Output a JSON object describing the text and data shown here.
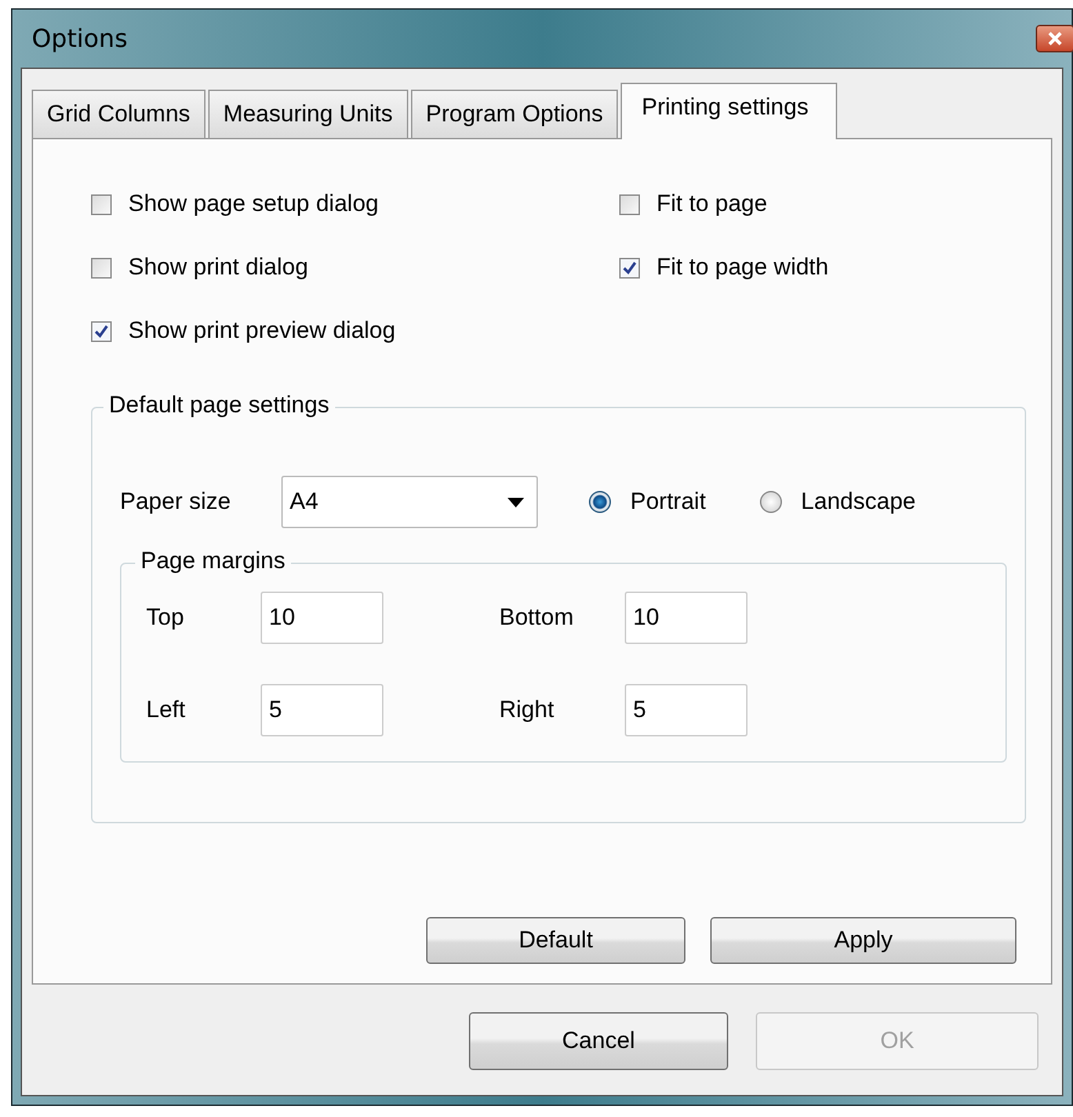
{
  "window": {
    "title": "Options"
  },
  "tabs": [
    {
      "label": "Grid Columns",
      "selected": false
    },
    {
      "label": "Measuring Units",
      "selected": false
    },
    {
      "label": "Program Options",
      "selected": false
    },
    {
      "label": "Printing settings",
      "selected": true
    }
  ],
  "options_left": [
    {
      "label": "Show page setup dialog",
      "checked": false
    },
    {
      "label": "Show print dialog",
      "checked": false
    },
    {
      "label": "Show print preview dialog",
      "checked": true
    }
  ],
  "options_right": [
    {
      "label": "Fit to page",
      "checked": false
    },
    {
      "label": "Fit to page width",
      "checked": true
    }
  ],
  "default_page_settings": {
    "title": "Default page settings",
    "paper_size_label": "Paper size",
    "paper_size": "A4",
    "orientation": [
      {
        "label": "Portrait",
        "selected": true
      },
      {
        "label": "Landscape",
        "selected": false
      }
    ],
    "page_margins": {
      "title": "Page margins",
      "fields": [
        {
          "label": "Top",
          "value": "10"
        },
        {
          "label": "Bottom",
          "value": "10"
        },
        {
          "label": "Left",
          "value": "5"
        },
        {
          "label": "Right",
          "value": "5"
        }
      ]
    }
  },
  "panel_buttons": [
    {
      "label": "Default",
      "disabled": false
    },
    {
      "label": "Apply",
      "disabled": false
    }
  ],
  "dialog_buttons": [
    {
      "label": "Cancel",
      "disabled": false
    },
    {
      "label": "OK",
      "disabled": true
    }
  ]
}
